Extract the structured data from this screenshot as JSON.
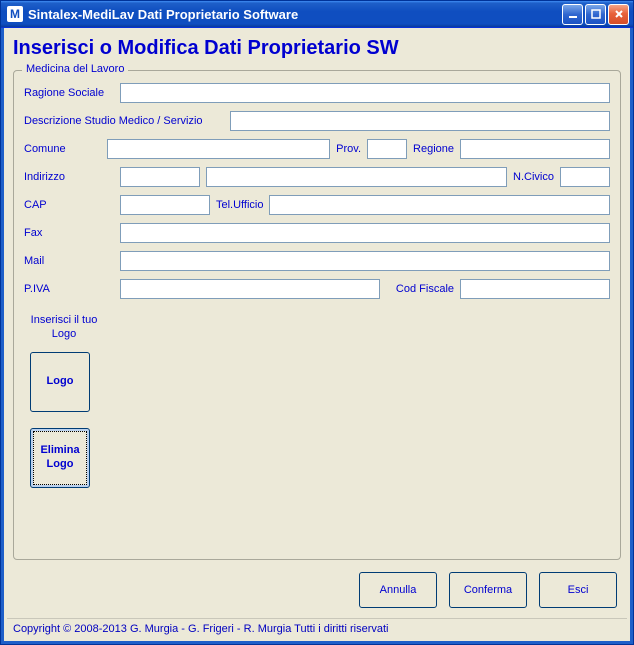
{
  "window": {
    "title": "Sintalex-MediLav  Dati Proprietario Software",
    "icon_letter": "M"
  },
  "heading": "Inserisci o Modifica Dati Proprietario SW",
  "group": {
    "legend": "Medicina del Lavoro",
    "labels": {
      "ragione_sociale": "Ragione Sociale",
      "descrizione": "Descrizione Studio Medico / Servizio",
      "comune": "Comune",
      "prov": "Prov.",
      "regione": "Regione",
      "indirizzo": "Indirizzo",
      "ncivico": "N.Civico",
      "cap": "CAP",
      "tel_ufficio": "Tel.Ufficio",
      "fax": "Fax",
      "mail": "Mail",
      "piva": "P.IVA",
      "cod_fiscale": "Cod Fiscale",
      "inserisci_logo": "Inserisci il tuo Logo"
    },
    "values": {
      "ragione_sociale": "",
      "descrizione": "",
      "comune": "",
      "prov": "",
      "regione": "",
      "indirizzo_a": "",
      "indirizzo_b": "",
      "ncivico": "",
      "cap": "",
      "tel_ufficio": "",
      "fax": "",
      "mail": "",
      "piva": "",
      "cod_fiscale": ""
    },
    "buttons": {
      "logo": "Logo",
      "elimina_logo": "Elimina Logo"
    }
  },
  "actions": {
    "annulla": "Annulla",
    "conferma": "Conferma",
    "esci": "Esci"
  },
  "footer": "Copyright  © 2008-2013 G. Murgia -  G. Frigeri -  R. Murgia Tutti i diritti riservati"
}
